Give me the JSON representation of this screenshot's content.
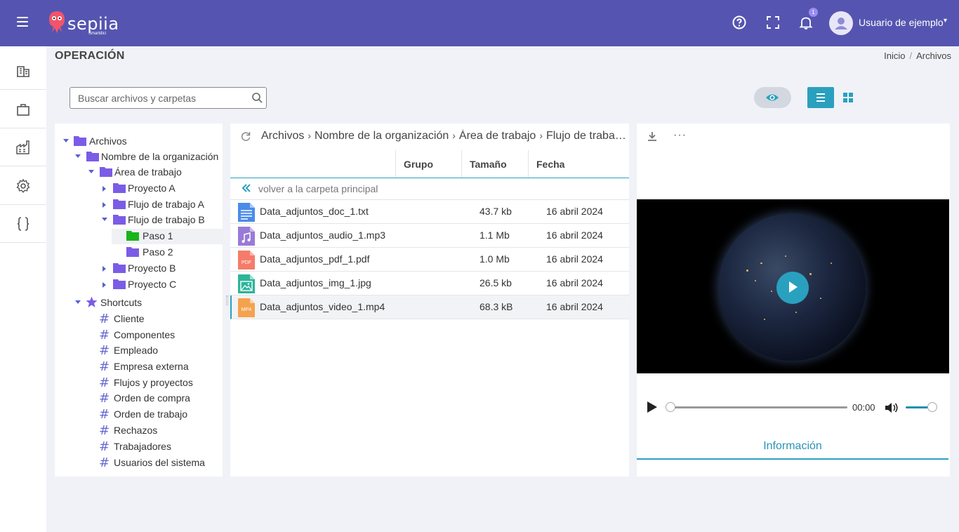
{
  "header": {
    "logo_text": "sepiia",
    "logo_sub": "Smartdici",
    "notification_count": "1",
    "user_name": "Usuario de ejemplo",
    "user_caret": "▾",
    "icons": [
      "menu-icon",
      "help-icon",
      "fullscreen-icon",
      "bell-icon",
      "user-avatar-icon"
    ]
  },
  "rail": {
    "items": [
      "building-icon",
      "briefcase-icon",
      "factory-icon",
      "gear-icon",
      "braces-icon"
    ]
  },
  "page": {
    "title": "OPERACIÓN",
    "breadcrumb": [
      "Inicio",
      "/",
      "Archivos"
    ]
  },
  "search": {
    "placeholder": "Buscar archivos y carpetas",
    "value": ""
  },
  "tree": {
    "root": "Archivos",
    "org": "Nombre de la organización",
    "area": "Área de trabajo",
    "items": {
      "proyecto_a": "Proyecto A",
      "flujo_a": "Flujo de trabajo A",
      "flujo_b": "Flujo de trabajo B",
      "paso_1": "Paso 1",
      "paso_2": "Paso 2",
      "proyecto_b": "Proyecto B",
      "proyecto_c": "Proyecto C"
    },
    "shortcuts_label": "Shortcuts",
    "shortcuts": [
      "Cliente",
      "Componentes",
      "Empleado",
      "Empresa externa",
      "Flujos y proyectos",
      "Orden de compra",
      "Orden de trabajo",
      "Rechazos",
      "Trabajadores",
      "Usuarios del sistema"
    ],
    "hash_symbol": "#"
  },
  "files": {
    "path": [
      "Archivos",
      "Nombre de la organización",
      "Área de trabajo",
      "Flujo de trabajo B"
    ],
    "path_sep": "›",
    "columns": {
      "grupo": "Grupo",
      "tamano": "Tamaño",
      "fecha": "Fecha"
    },
    "back_label": "volver a la carpeta principal",
    "rows": [
      {
        "name": "Data_adjuntos_doc_1.txt",
        "size": "43.7 kb",
        "date": "16 abril 2024",
        "icon": "text-file-icon"
      },
      {
        "name": "Data_adjuntos_audio_1.mp3",
        "size": "1.1 Mb",
        "date": "16 abril 2024",
        "icon": "audio-file-icon"
      },
      {
        "name": "Data_adjuntos_pdf_1.pdf",
        "size": "1.0 Mb",
        "date": "16 abril 2024",
        "icon": "pdf-file-icon"
      },
      {
        "name": "Data_adjuntos_img_1.jpg",
        "size": "26.5 kb",
        "date": "16 abril 2024",
        "icon": "image-file-icon"
      },
      {
        "name": "Data_adjuntos_video_1.mp4",
        "size": "68.3 kB",
        "date": "16 abril 2024",
        "icon": "video-file-icon"
      }
    ],
    "pdf_tag": "PDF",
    "mp4_tag": "MP4"
  },
  "preview": {
    "more": "···",
    "time": "00:00",
    "info_tab": "Información"
  },
  "colors": {
    "topbar": "#5555b1",
    "accent": "#2aa0bf",
    "folder": "#7b5ce6",
    "folder_selected": "#1ab51a"
  }
}
